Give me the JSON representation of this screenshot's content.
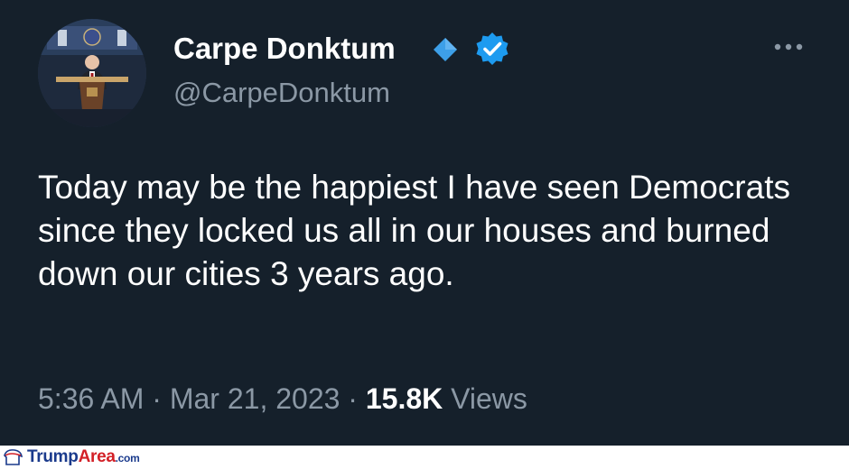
{
  "user": {
    "display_name": "Carpe Donktum",
    "handle": "@CarpeDonktum"
  },
  "icons": {
    "more": "more-options-icon",
    "diamond": "diamond-badge-icon",
    "verified": "verified-badge-icon"
  },
  "colors": {
    "background": "#15202b",
    "secondary_text": "#8b98a5",
    "verified_blue": "#1d9bf0",
    "logo_blue": "#1a3a8c",
    "logo_red": "#d32027"
  },
  "tweet": {
    "text": "Today may be the happiest I have seen Democrats since they locked us all in our houses and burned down our cities 3 years ago.",
    "time": "5:36 AM",
    "date": "Mar 21, 2023",
    "separator": "·",
    "views_count": "15.8K",
    "views_label": "Views"
  },
  "watermark": {
    "part1": "Trump",
    "part2": "Area",
    "part3": ".com"
  }
}
